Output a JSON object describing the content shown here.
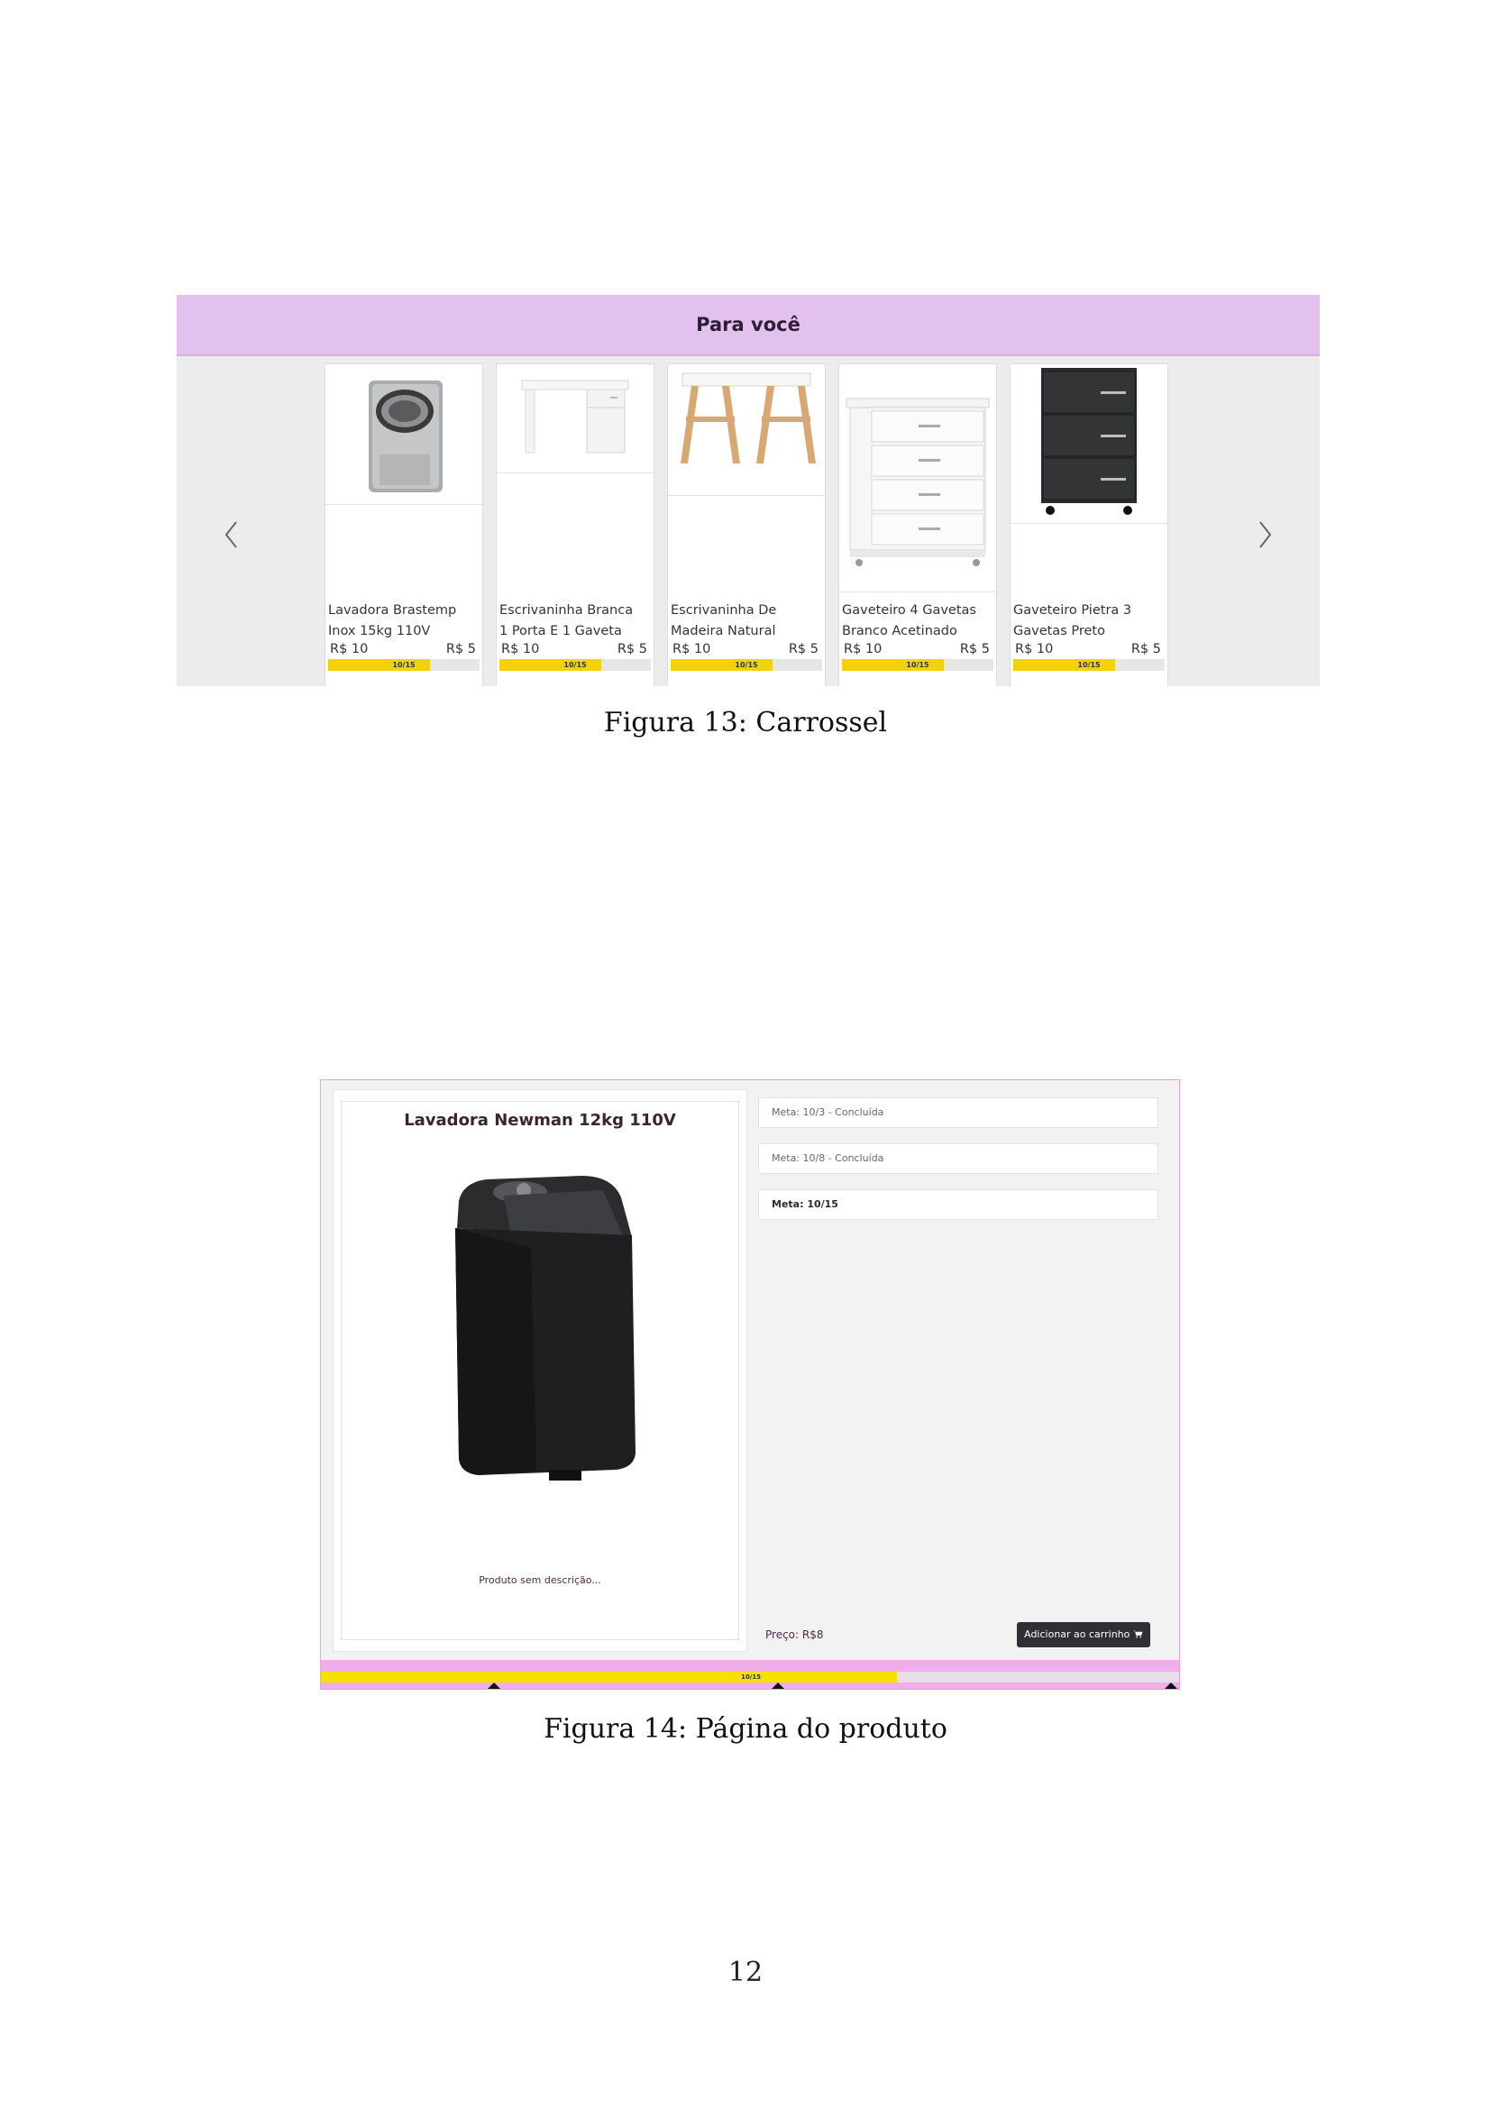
{
  "figure13": {
    "section_title": "Para você",
    "arrow_left_icon": "chevron-left-icon",
    "arrow_right_icon": "chevron-right-icon",
    "cards": [
      {
        "name_line1": "Lavadora Brastemp",
        "name_line2": "Inox 15kg 110V",
        "price_old": "R$ 10",
        "price_new": "R$ 5",
        "progress_label": "10/15",
        "progress": 0.67,
        "image": "washing-machine-image"
      },
      {
        "name_line1": "Escrivaninha Branca",
        "name_line2": "1 Porta E 1 Gaveta",
        "price_old": "R$ 10",
        "price_new": "R$ 5",
        "progress_label": "10/15",
        "progress": 0.67,
        "image": "white-desk-image"
      },
      {
        "name_line1": "Escrivaninha De",
        "name_line2": "Madeira Natural",
        "price_old": "R$ 10",
        "price_new": "R$ 5",
        "progress_label": "10/15",
        "progress": 0.67,
        "image": "wooden-desk-image"
      },
      {
        "name_line1": "Gaveteiro 4 Gavetas",
        "name_line2": "Branco Acetinado",
        "price_old": "R$ 10",
        "price_new": "R$ 5",
        "progress_label": "10/15",
        "progress": 0.67,
        "image": "white-drawer-image"
      },
      {
        "name_line1": "Gaveteiro Pietra 3",
        "name_line2": "Gavetas Preto",
        "price_old": "R$ 10",
        "price_new": "R$ 5",
        "progress_label": "10/15",
        "progress": 0.67,
        "image": "black-drawer-image"
      }
    ],
    "caption": "Figura 13: Carrossel"
  },
  "figure14": {
    "product_title": "Lavadora Newman 12kg 110V",
    "product_description": "Produto sem descrição...",
    "metas": [
      {
        "text": "Meta: 10/3 - Concluída",
        "current": false
      },
      {
        "text": "Meta: 10/8 - Concluída",
        "current": false
      },
      {
        "text": "Meta: 10/15",
        "current": true
      }
    ],
    "price_label": "Preço: R$8",
    "cart_button_label": "Adicionar ao carrinho",
    "cart_icon": "cart-icon",
    "progress_label": "10/15",
    "progress": 0.67,
    "caption": "Figura 14: Página do produto"
  },
  "page_number": "12",
  "colors": {
    "carousel_band": "#e3c1ef",
    "progress_yellow": "#f3d20c",
    "product_border": "#ee9be6",
    "cart_button": "#2f2f36"
  }
}
